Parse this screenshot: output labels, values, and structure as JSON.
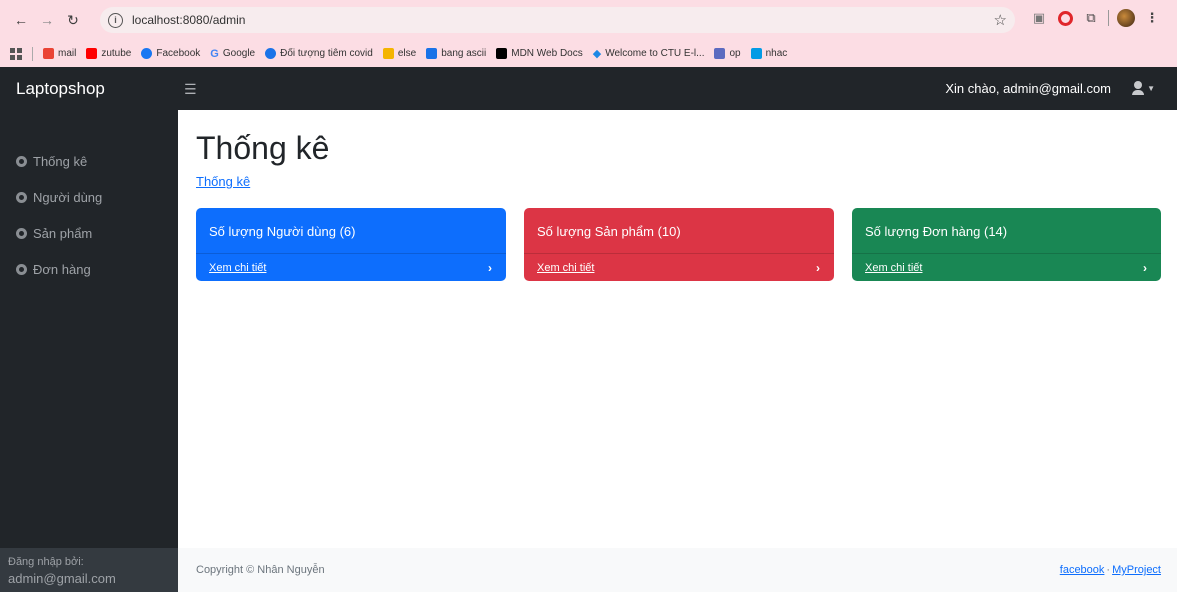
{
  "browser": {
    "url": "localhost:8080/admin",
    "bookmarks": [
      {
        "label": "mail",
        "color": "#ea4335"
      },
      {
        "label": "zutube",
        "color": "#ff0000"
      },
      {
        "label": "Facebook",
        "color": "#1877f2"
      },
      {
        "label": "Google",
        "color": "#4285f4"
      },
      {
        "label": "Đối tượng tiêm covid",
        "color": "#1a73e8"
      },
      {
        "label": "else",
        "color": "#f4b400"
      },
      {
        "label": "bang ascii",
        "color": "#1a73e8"
      },
      {
        "label": "MDN Web Docs",
        "color": "#000000"
      },
      {
        "label": "Welcome to CTU E-l...",
        "color": "#1e88e5"
      },
      {
        "label": "op",
        "color": "#5c6bc0"
      },
      {
        "label": "nhac",
        "color": "#039be5"
      }
    ]
  },
  "topnav": {
    "brand": "Laptopshop",
    "greeting": "Xin chào, admin@gmail.com"
  },
  "sidebar": {
    "items": [
      {
        "label": "Thống kê"
      },
      {
        "label": "Người dùng"
      },
      {
        "label": "Sản phẩm"
      },
      {
        "label": "Đơn hàng"
      }
    ],
    "footer_label": "Đăng nhập bởi:",
    "footer_user": "admin@gmail.com"
  },
  "main": {
    "title": "Thống kê",
    "breadcrumb": "Thống kê",
    "cards": [
      {
        "title": "Số lượng Người dùng (6)",
        "link": "Xem chi tiết",
        "color": "#0d6efd"
      },
      {
        "title": "Số lượng Sản phẩm (10)",
        "link": "Xem chi tiết",
        "color": "#dc3545"
      },
      {
        "title": "Số lượng Đơn hàng (14)",
        "link": "Xem chi tiết",
        "color": "#198754"
      }
    ]
  },
  "footer": {
    "copyright": "Copyright © Nhân Nguyễn",
    "link1": "facebook",
    "separator": "·",
    "link2": "MyProject"
  }
}
